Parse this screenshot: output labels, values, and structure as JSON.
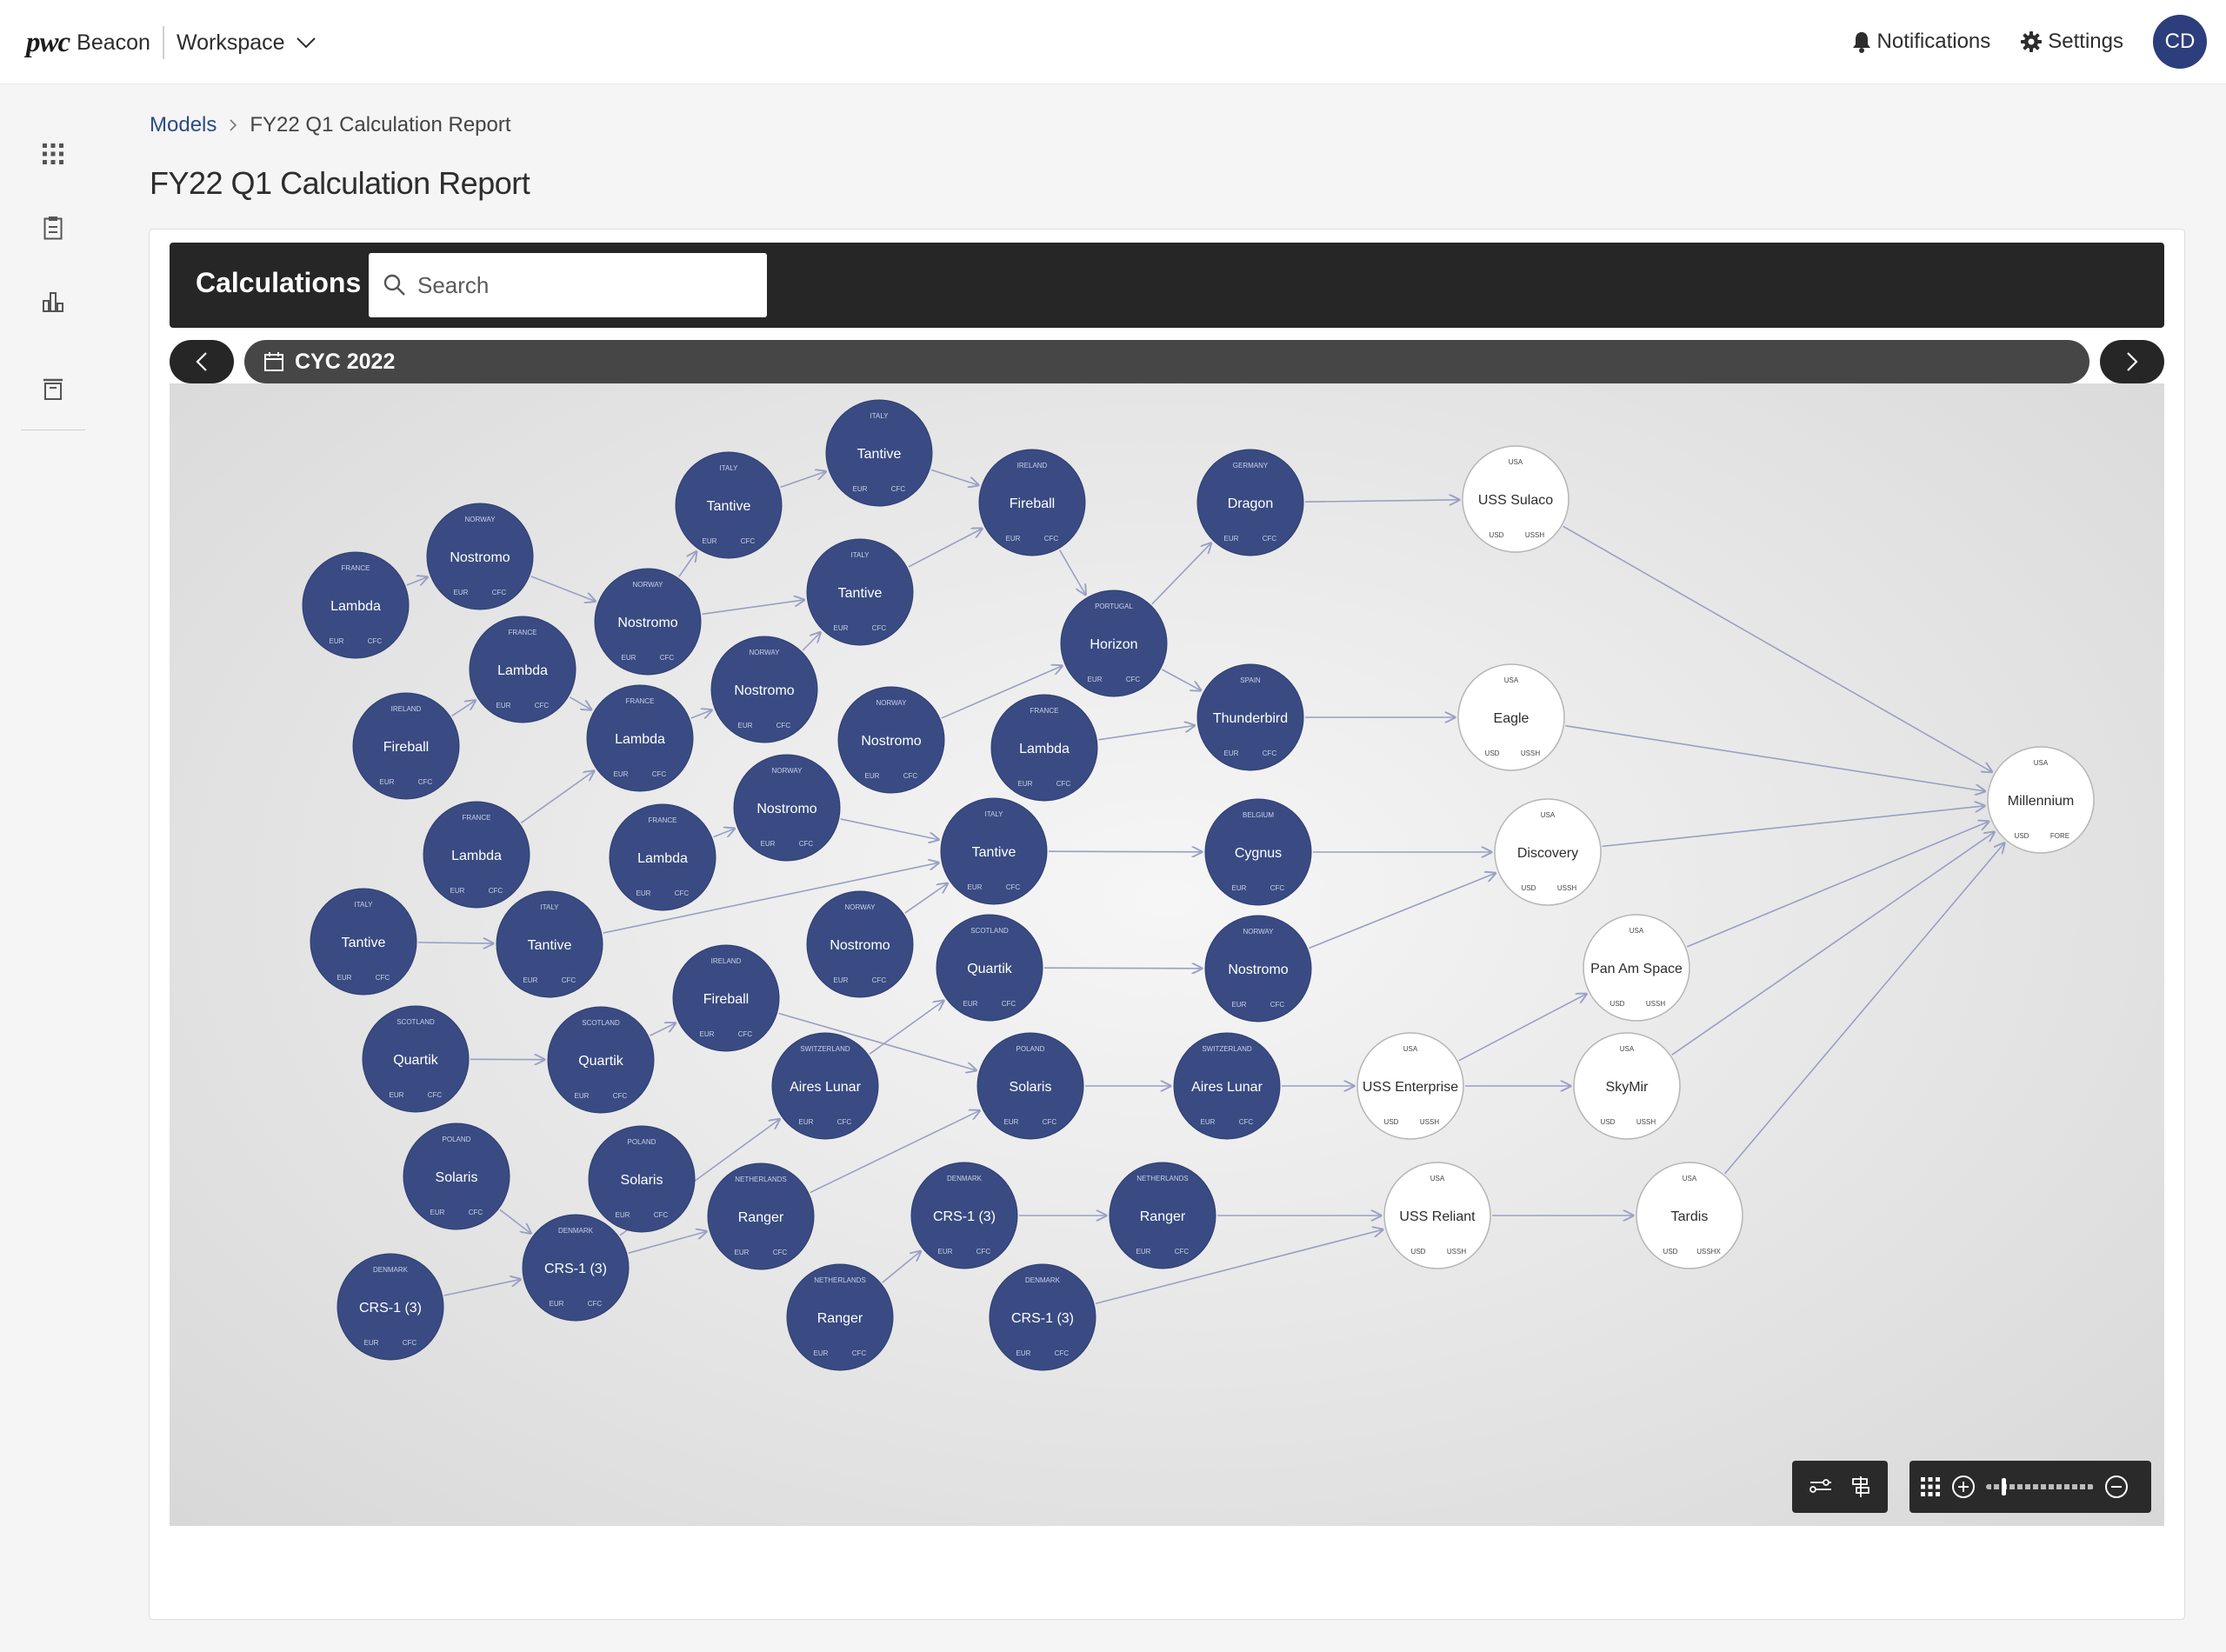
{
  "topbar": {
    "brand_logo": "pwc",
    "brand_name": "Beacon",
    "workspace_label": "Workspace",
    "notifications_label": "Notifications",
    "settings_label": "Settings",
    "avatar_initials": "CD"
  },
  "sidebar": {
    "items": [
      {
        "icon": "grid-icon"
      },
      {
        "icon": "clipboard-icon"
      },
      {
        "icon": "bar-chart-icon"
      },
      {
        "icon": "archive-icon"
      }
    ]
  },
  "breadcrumb": {
    "root": "Models",
    "current": "FY22 Q1 Calculation Report"
  },
  "page_title": "FY22 Q1 Calculation Report",
  "calculations": {
    "title": "Calculations",
    "search_placeholder": "Search"
  },
  "timeline": {
    "label": "CYC 2022"
  },
  "colors": {
    "node_fill": "#394b82",
    "node_text": "#ffffff",
    "output_fill": "#ffffff",
    "edge": "#9a9fc4",
    "accent": "#2c3e7b"
  },
  "graph": {
    "nodes": [
      {
        "id": "n1",
        "name": "Lambda",
        "country": "FRANCE",
        "c1": "EUR",
        "c2": "CFC",
        "type": "calc"
      },
      {
        "id": "n2",
        "name": "Nostromo",
        "country": "NORWAY",
        "c1": "EUR",
        "c2": "CFC",
        "type": "calc"
      },
      {
        "id": "n3",
        "name": "Lambda",
        "country": "FRANCE",
        "c1": "EUR",
        "c2": "CFC",
        "type": "calc"
      },
      {
        "id": "n4",
        "name": "Fireball",
        "country": "IRELAND",
        "c1": "EUR",
        "c2": "CFC",
        "type": "calc"
      },
      {
        "id": "n5",
        "name": "Lambda",
        "country": "FRANCE",
        "c1": "EUR",
        "c2": "CFC",
        "type": "calc"
      },
      {
        "id": "n6",
        "name": "Tantive",
        "country": "ITALY",
        "c1": "EUR",
        "c2": "CFC",
        "type": "calc"
      },
      {
        "id": "n7",
        "name": "Tantive",
        "country": "ITALY",
        "c1": "EUR",
        "c2": "CFC",
        "type": "calc"
      },
      {
        "id": "n8",
        "name": "Quartik",
        "country": "SCOTLAND",
        "c1": "EUR",
        "c2": "CFC",
        "type": "calc"
      },
      {
        "id": "n9",
        "name": "Quartik",
        "country": "SCOTLAND",
        "c1": "EUR",
        "c2": "CFC",
        "type": "calc"
      },
      {
        "id": "n10",
        "name": "Solaris",
        "country": "POLAND",
        "c1": "EUR",
        "c2": "CFC",
        "type": "calc"
      },
      {
        "id": "n11",
        "name": "Solaris",
        "country": "POLAND",
        "c1": "EUR",
        "c2": "CFC",
        "type": "calc"
      },
      {
        "id": "n12",
        "name": "CRS-1 (3)",
        "country": "DENMARK",
        "c1": "EUR",
        "c2": "CFC",
        "type": "calc"
      },
      {
        "id": "n13",
        "name": "CRS-1 (3)",
        "country": "DENMARK",
        "c1": "EUR",
        "c2": "CFC",
        "type": "calc"
      },
      {
        "id": "n14",
        "name": "Tantive",
        "country": "ITALY",
        "c1": "EUR",
        "c2": "CFC",
        "type": "calc"
      },
      {
        "id": "n15",
        "name": "Nostromo",
        "country": "NORWAY",
        "c1": "EUR",
        "c2": "CFC",
        "type": "calc"
      },
      {
        "id": "n16",
        "name": "Lambda",
        "country": "FRANCE",
        "c1": "EUR",
        "c2": "CFC",
        "type": "calc"
      },
      {
        "id": "n17",
        "name": "Lambda",
        "country": "FRANCE",
        "c1": "EUR",
        "c2": "CFC",
        "type": "calc"
      },
      {
        "id": "n18",
        "name": "Fireball",
        "country": "IRELAND",
        "c1": "EUR",
        "c2": "CFC",
        "type": "calc"
      },
      {
        "id": "n19",
        "name": "Tantive",
        "country": "ITALY",
        "c1": "EUR",
        "c2": "CFC",
        "type": "calc"
      },
      {
        "id": "n20",
        "name": "Tantive",
        "country": "ITALY",
        "c1": "EUR",
        "c2": "CFC",
        "type": "calc"
      },
      {
        "id": "n21",
        "name": "Nostromo",
        "country": "NORWAY",
        "c1": "EUR",
        "c2": "CFC",
        "type": "calc"
      },
      {
        "id": "n22",
        "name": "Nostromo",
        "country": "NORWAY",
        "c1": "EUR",
        "c2": "CFC",
        "type": "calc"
      },
      {
        "id": "n23",
        "name": "Nostromo",
        "country": "NORWAY",
        "c1": "EUR",
        "c2": "CFC",
        "type": "calc"
      },
      {
        "id": "n24",
        "name": "Aires Lunar",
        "country": "SWITZERLAND",
        "c1": "EUR",
        "c2": "CFC",
        "type": "calc"
      },
      {
        "id": "n25",
        "name": "Ranger",
        "country": "NETHERLANDS",
        "c1": "EUR",
        "c2": "CFC",
        "type": "calc"
      },
      {
        "id": "n26",
        "name": "Ranger",
        "country": "NETHERLANDS",
        "c1": "EUR",
        "c2": "CFC",
        "type": "calc"
      },
      {
        "id": "n27",
        "name": "Fireball",
        "country": "IRELAND",
        "c1": "EUR",
        "c2": "CFC",
        "type": "calc"
      },
      {
        "id": "n28",
        "name": "Nostromo",
        "country": "NORWAY",
        "c1": "EUR",
        "c2": "CFC",
        "type": "calc"
      },
      {
        "id": "n29",
        "name": "Horizon",
        "country": "PORTUGAL",
        "c1": "EUR",
        "c2": "CFC",
        "type": "calc"
      },
      {
        "id": "n30",
        "name": "Lambda",
        "country": "FRANCE",
        "c1": "EUR",
        "c2": "CFC",
        "type": "calc"
      },
      {
        "id": "n31",
        "name": "Tantive",
        "country": "ITALY",
        "c1": "EUR",
        "c2": "CFC",
        "type": "calc"
      },
      {
        "id": "n32",
        "name": "Quartik",
        "country": "SCOTLAND",
        "c1": "EUR",
        "c2": "CFC",
        "type": "calc"
      },
      {
        "id": "n33",
        "name": "Solaris",
        "country": "POLAND",
        "c1": "EUR",
        "c2": "CFC",
        "type": "calc"
      },
      {
        "id": "n34",
        "name": "CRS-1 (3)",
        "country": "DENMARK",
        "c1": "EUR",
        "c2": "CFC",
        "type": "calc"
      },
      {
        "id": "n35",
        "name": "CRS-1 (3)",
        "country": "DENMARK",
        "c1": "EUR",
        "c2": "CFC",
        "type": "calc"
      },
      {
        "id": "n36",
        "name": "Dragon",
        "country": "GERMANY",
        "c1": "EUR",
        "c2": "CFC",
        "type": "calc"
      },
      {
        "id": "n37",
        "name": "Thunderbird",
        "country": "SPAIN",
        "c1": "EUR",
        "c2": "CFC",
        "type": "calc"
      },
      {
        "id": "n38",
        "name": "Cygnus",
        "country": "BELGIUM",
        "c1": "EUR",
        "c2": "CFC",
        "type": "calc"
      },
      {
        "id": "n39",
        "name": "Nostromo",
        "country": "NORWAY",
        "c1": "EUR",
        "c2": "CFC",
        "type": "calc"
      },
      {
        "id": "n40",
        "name": "Aires Lunar",
        "country": "SWITZERLAND",
        "c1": "EUR",
        "c2": "CFC",
        "type": "calc"
      },
      {
        "id": "n41",
        "name": "Ranger",
        "country": "NETHERLANDS",
        "c1": "EUR",
        "c2": "CFC",
        "type": "calc"
      },
      {
        "id": "o1",
        "name": "USS Sulaco",
        "country": "USA",
        "c1": "USD",
        "c2": "USSH",
        "type": "output"
      },
      {
        "id": "o2",
        "name": "Eagle",
        "country": "USA",
        "c1": "USD",
        "c2": "USSH",
        "type": "output"
      },
      {
        "id": "o3",
        "name": "Discovery",
        "country": "USA",
        "c1": "USD",
        "c2": "USSH",
        "type": "output"
      },
      {
        "id": "o4",
        "name": "Pan Am Space",
        "country": "USA",
        "c1": "USD",
        "c2": "USSH",
        "type": "output"
      },
      {
        "id": "o5",
        "name": "USS Enterprise",
        "country": "USA",
        "c1": "USD",
        "c2": "USSH",
        "type": "output"
      },
      {
        "id": "o6",
        "name": "SkyMir",
        "country": "USA",
        "c1": "USD",
        "c2": "USSH",
        "type": "output"
      },
      {
        "id": "o7",
        "name": "USS Reliant",
        "country": "USA",
        "c1": "USD",
        "c2": "USSH",
        "type": "output"
      },
      {
        "id": "o8",
        "name": "Tardis",
        "country": "USA",
        "c1": "USD",
        "c2": "USSHX",
        "type": "output"
      },
      {
        "id": "o9",
        "name": "Millennium",
        "country": "USA",
        "c1": "USD",
        "c2": "FORE",
        "type": "output"
      }
    ],
    "edges": [
      [
        "n1",
        "n2"
      ],
      [
        "n2",
        "n15"
      ],
      [
        "n15",
        "n14"
      ],
      [
        "n14",
        "n19"
      ],
      [
        "n19",
        "n27"
      ],
      [
        "n27",
        "n29"
      ],
      [
        "n15",
        "n20"
      ],
      [
        "n20",
        "n27"
      ],
      [
        "n4",
        "n3"
      ],
      [
        "n3",
        "n16"
      ],
      [
        "n16",
        "n21"
      ],
      [
        "n21",
        "n20"
      ],
      [
        "n5",
        "n16"
      ],
      [
        "n17",
        "n22"
      ],
      [
        "n22",
        "n31"
      ],
      [
        "n28",
        "n29"
      ],
      [
        "n29",
        "n36"
      ],
      [
        "n29",
        "n37"
      ],
      [
        "n30",
        "n37"
      ],
      [
        "n6",
        "n7"
      ],
      [
        "n7",
        "n31"
      ],
      [
        "n8",
        "n9"
      ],
      [
        "n9",
        "n18"
      ],
      [
        "n18",
        "n33"
      ],
      [
        "n10",
        "n12"
      ],
      [
        "n12",
        "n24"
      ],
      [
        "n24",
        "n32"
      ],
      [
        "n23",
        "n31"
      ],
      [
        "n31",
        "n38"
      ],
      [
        "n32",
        "n39"
      ],
      [
        "n33",
        "n40"
      ],
      [
        "n13",
        "n12"
      ],
      [
        "n12",
        "n25"
      ],
      [
        "n25",
        "n33"
      ],
      [
        "n26",
        "n34"
      ],
      [
        "n34",
        "n41"
      ],
      [
        "n36",
        "o1"
      ],
      [
        "n37",
        "o2"
      ],
      [
        "n38",
        "o3"
      ],
      [
        "n39",
        "o3"
      ],
      [
        "n40",
        "o5"
      ],
      [
        "o5",
        "o4"
      ],
      [
        "o5",
        "o6"
      ],
      [
        "n41",
        "o7"
      ],
      [
        "n35",
        "o7"
      ],
      [
        "o7",
        "o8"
      ],
      [
        "o1",
        "o9"
      ],
      [
        "o2",
        "o9"
      ],
      [
        "o3",
        "o9"
      ],
      [
        "o4",
        "o9"
      ],
      [
        "o6",
        "o9"
      ],
      [
        "o8",
        "o9"
      ]
    ]
  },
  "controls": {
    "filter_icon": "filter-icon",
    "tree_icon": "hierarchy-icon",
    "grid_icon": "grid-icon",
    "zoom_in_icon": "zoom-in-icon",
    "zoom_out_icon": "zoom-out-icon",
    "zoom_level": 0.15
  }
}
